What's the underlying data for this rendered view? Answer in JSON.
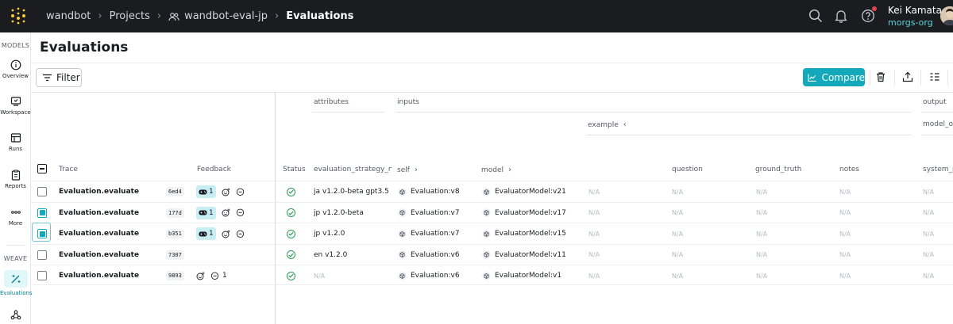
{
  "topbar": {
    "breadcrumbs": [
      {
        "label": "wandbot"
      },
      {
        "label": "Projects"
      },
      {
        "label": "wandbot-eval-jp"
      },
      {
        "label": "Evaluations"
      }
    ],
    "user_name": "Kei Kamata",
    "user_org": "morgs-org"
  },
  "nav": {
    "models_section": "MODELS",
    "weave_section": "WEAVE",
    "items": [
      {
        "label": "Overview"
      },
      {
        "label": "Workspace"
      },
      {
        "label": "Runs"
      },
      {
        "label": "Reports"
      },
      {
        "label": "More"
      },
      {
        "label": "Evaluations"
      }
    ]
  },
  "page": {
    "title": "Evaluations",
    "filter_label": "Filter",
    "compare_label": "Compare"
  },
  "columns": {
    "group_attributes": "attributes",
    "group_inputs": "inputs",
    "group_output": "output",
    "example": "example",
    "model_output": "model_o",
    "trace": "Trace",
    "feedback": "Feedback",
    "status": "Status",
    "evaluation_strategy": "evaluation_strategy_n",
    "self": "self",
    "model": "model",
    "question": "question",
    "ground_truth": "ground_truth",
    "notes": "notes",
    "system": "system_p"
  },
  "rows": [
    {
      "trace": "Evaluation.evaluate",
      "hash": "6ed4",
      "reaction_count": "1",
      "comment_count": "",
      "strategy": "ja v1.2.0-beta gpt3.5",
      "self": "Evaluation:v8",
      "model": "EvaluatorModel:v21",
      "question": "N/A",
      "ground_truth": "N/A",
      "notes": "N/A",
      "system": "N/A"
    },
    {
      "trace": "Evaluation.evaluate",
      "hash": "177d",
      "reaction_count": "1",
      "comment_count": "",
      "strategy": "jp v1.2.0-beta",
      "self": "Evaluation:v7",
      "model": "EvaluatorModel:v17",
      "question": "N/A",
      "ground_truth": "N/A",
      "notes": "N/A",
      "system": "N/A"
    },
    {
      "trace": "Evaluation.evaluate",
      "hash": "b351",
      "reaction_count": "1",
      "comment_count": "",
      "strategy": "jp v1.2.0",
      "self": "Evaluation:v7",
      "model": "EvaluatorModel:v15",
      "question": "N/A",
      "ground_truth": "N/A",
      "notes": "N/A",
      "system": "N/A"
    },
    {
      "trace": "Evaluation.evaluate",
      "hash": "7307",
      "reaction_count": "",
      "comment_count": "",
      "strategy": "en v1.2.0",
      "self": "Evaluation:v6",
      "model": "EvaluatorModel:v11",
      "question": "N/A",
      "ground_truth": "N/A",
      "notes": "N/A",
      "system": "N/A"
    },
    {
      "trace": "Evaluation.evaluate",
      "hash": "9893",
      "reaction_count": "",
      "comment_count": "1",
      "strategy": "N/A",
      "self": "Evaluation:v6",
      "model": "EvaluatorModel:v1",
      "question": "N/A",
      "ground_truth": "N/A",
      "notes": "N/A",
      "system": "N/A"
    }
  ],
  "colors": {
    "accent": "#13a9ba",
    "topbar_bg": "#1a1c1f",
    "org_link": "#58d3db",
    "status_ok": "#2e9b58",
    "notification_dot": "#e0454f"
  }
}
